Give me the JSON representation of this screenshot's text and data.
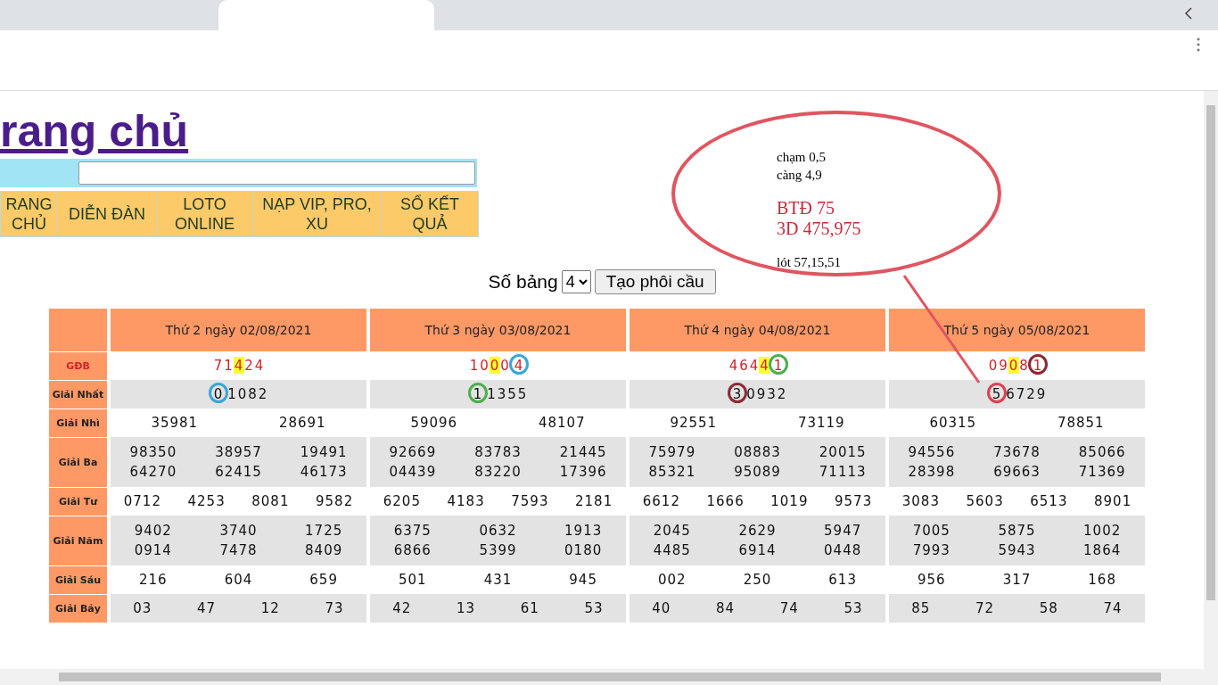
{
  "heading": "rang chủ",
  "nav": [
    {
      "label": "RANG CHỦ"
    },
    {
      "label": "DIỄN ĐÀN"
    },
    {
      "label": "LOTO ONLINE"
    },
    {
      "label": "NẠP VIP, PRO, XU"
    },
    {
      "label": "SỔ KẾT QUẢ"
    }
  ],
  "controls": {
    "label": "Số bảng",
    "table_count": "4",
    "button": "Tạo phôi cầu"
  },
  "days": [
    "Thứ 2 ngày 02/08/2021",
    "Thứ 3 ngày 03/08/2021",
    "Thứ 4 ngày 04/08/2021",
    "Thứ 5 ngày 05/08/2021"
  ],
  "rows": [
    {
      "label": "GĐB",
      "kind": "special",
      "cells": [
        {
          "digits": [
            {
              "text": "7",
              "highlighted": false,
              "circled": false
            },
            {
              "text": "1",
              "highlighted": false,
              "circled": false
            },
            {
              "text": "4",
              "highlighted": true,
              "circled": false
            },
            {
              "text": "2",
              "highlighted": false,
              "circled": false
            },
            {
              "text": "4",
              "highlighted": false,
              "circled": false
            }
          ]
        },
        {
          "digits": [
            {
              "text": "1",
              "highlighted": false,
              "circled": false
            },
            {
              "text": "0",
              "highlighted": false,
              "circled": false
            },
            {
              "text": "0",
              "highlighted": true,
              "circled": false
            },
            {
              "text": "0",
              "highlighted": false,
              "circled": false
            },
            {
              "text": "4",
              "highlighted": false,
              "circled": true,
              "color": "#3aa6d8"
            }
          ]
        },
        {
          "digits": [
            {
              "text": "4",
              "highlighted": false,
              "circled": false
            },
            {
              "text": "6",
              "highlighted": false,
              "circled": false
            },
            {
              "text": "4",
              "highlighted": false,
              "circled": false
            },
            {
              "text": "4",
              "highlighted": true,
              "circled": false
            },
            {
              "text": "1",
              "highlighted": false,
              "circled": true,
              "color": "#4caf50"
            }
          ]
        },
        {
          "digits": [
            {
              "text": "0",
              "highlighted": false,
              "circled": false
            },
            {
              "text": "9",
              "highlighted": false,
              "circled": false
            },
            {
              "text": "0",
              "highlighted": true,
              "circled": false
            },
            {
              "text": "8",
              "highlighted": false,
              "circled": false
            },
            {
              "text": "1",
              "highlighted": false,
              "circled": true,
              "color": "#8b2a35"
            }
          ]
        }
      ]
    },
    {
      "label": "Giải Nhất",
      "kind": "first",
      "cells": [
        {
          "digits": [
            {
              "text": "0",
              "highlighted": false,
              "circled": true,
              "color": "#3aa6d8"
            },
            {
              "text": "1",
              "highlighted": false,
              "circled": false
            },
            {
              "text": "0",
              "highlighted": false,
              "circled": false
            },
            {
              "text": "8",
              "highlighted": false,
              "circled": false
            },
            {
              "text": "2",
              "highlighted": false,
              "circled": false
            }
          ]
        },
        {
          "digits": [
            {
              "text": "1",
              "highlighted": false,
              "circled": true,
              "color": "#4caf50"
            },
            {
              "text": "1",
              "highlighted": false,
              "circled": false
            },
            {
              "text": "3",
              "highlighted": false,
              "circled": false
            },
            {
              "text": "5",
              "highlighted": false,
              "circled": false
            },
            {
              "text": "5",
              "highlighted": false,
              "circled": false
            }
          ]
        },
        {
          "digits": [
            {
              "text": "3",
              "highlighted": false,
              "circled": true,
              "color": "#8b2a35"
            },
            {
              "text": "0",
              "highlighted": false,
              "circled": false
            },
            {
              "text": "9",
              "highlighted": false,
              "circled": false
            },
            {
              "text": "3",
              "highlighted": false,
              "circled": false
            },
            {
              "text": "2",
              "highlighted": false,
              "circled": false
            }
          ]
        },
        {
          "digits": [
            {
              "text": "5",
              "highlighted": false,
              "circled": true,
              "color": "#e04050"
            },
            {
              "text": "6",
              "highlighted": false,
              "circled": false
            },
            {
              "text": "7",
              "highlighted": false,
              "circled": false
            },
            {
              "text": "2",
              "highlighted": false,
              "circled": false
            },
            {
              "text": "9",
              "highlighted": false,
              "circled": false
            }
          ]
        }
      ]
    },
    {
      "label": "Giải Nhì",
      "kind": "second",
      "cells": [
        {
          "numbers": [
            "35981",
            "28691"
          ]
        },
        {
          "numbers": [
            "59096",
            "48107"
          ]
        },
        {
          "numbers": [
            "92551",
            "73119"
          ]
        },
        {
          "numbers": [
            "60315",
            "78851"
          ]
        }
      ]
    },
    {
      "label": "Giải Ba",
      "kind": "third",
      "cells": [
        {
          "numbers": [
            "98350",
            "38957",
            "19491",
            "64270",
            "62415",
            "46173"
          ]
        },
        {
          "numbers": [
            "92669",
            "83783",
            "21445",
            "04439",
            "83220",
            "17396"
          ]
        },
        {
          "numbers": [
            "75979",
            "08883",
            "20015",
            "85321",
            "95089",
            "71113"
          ]
        },
        {
          "numbers": [
            "94556",
            "73678",
            "85066",
            "28398",
            "69663",
            "71369"
          ]
        }
      ]
    },
    {
      "label": "Giải Tư",
      "kind": "fourth",
      "cells": [
        {
          "numbers": [
            "0712",
            "4253",
            "8081",
            "9582"
          ]
        },
        {
          "numbers": [
            "6205",
            "4183",
            "7593",
            "2181"
          ]
        },
        {
          "numbers": [
            "6612",
            "1666",
            "1019",
            "9573"
          ]
        },
        {
          "numbers": [
            "3083",
            "5603",
            "6513",
            "8901"
          ]
        }
      ]
    },
    {
      "label": "Giải Năm",
      "kind": "fifth",
      "cells": [
        {
          "numbers": [
            "9402",
            "3740",
            "1725",
            "0914",
            "7478",
            "8409"
          ]
        },
        {
          "numbers": [
            "6375",
            "0632",
            "1913",
            "6866",
            "5399",
            "0180"
          ]
        },
        {
          "numbers": [
            "2045",
            "2629",
            "5947",
            "4485",
            "6914",
            "0448"
          ]
        },
        {
          "numbers": [
            "7005",
            "5875",
            "1002",
            "7993",
            "5943",
            "1864"
          ]
        }
      ]
    },
    {
      "label": "Giải Sáu",
      "kind": "sixth",
      "cells": [
        {
          "numbers": [
            "216",
            "604",
            "659"
          ]
        },
        {
          "numbers": [
            "501",
            "431",
            "945"
          ]
        },
        {
          "numbers": [
            "002",
            "250",
            "613"
          ]
        },
        {
          "numbers": [
            "956",
            "317",
            "168"
          ]
        }
      ]
    },
    {
      "label": "Giải Bảy",
      "kind": "seventh",
      "cells": [
        {
          "numbers": [
            "03",
            "47",
            "12",
            "73"
          ]
        },
        {
          "numbers": [
            "42",
            "13",
            "61",
            "53"
          ]
        },
        {
          "numbers": [
            "40",
            "84",
            "74",
            "53"
          ]
        },
        {
          "numbers": [
            "85",
            "72",
            "58",
            "74"
          ]
        }
      ]
    }
  ],
  "callout": {
    "color": "#e05560",
    "lines": [
      {
        "text": "chạm 0,5",
        "kind": "note"
      },
      {
        "text": "càng 4,9",
        "kind": "note"
      },
      {
        "text": "BTĐ 75",
        "kind": "accent"
      },
      {
        "text": "3D 475,975",
        "kind": "accent"
      },
      {
        "text": "lót 57,15,51",
        "kind": "note"
      }
    ]
  }
}
